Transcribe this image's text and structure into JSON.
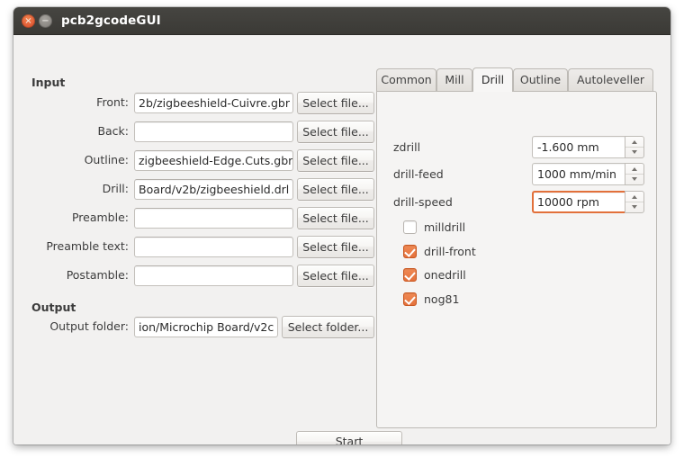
{
  "window": {
    "title": "pcb2gcodeGUI",
    "close_icon": "close-icon",
    "close_glyph": "×",
    "minimize_icon": "minimize-icon",
    "minimize_glyph": "−"
  },
  "colors": {
    "titlebar": "#3b3a36",
    "close_button": "#e4613a",
    "minimize_button": "#8e8b86",
    "accent": "#e4713c",
    "focus_ring": "#e2703a",
    "window_bg": "#f2f1f0",
    "panel_bg": "#f5f4f3"
  },
  "input_section": {
    "title": "Input",
    "rows": [
      {
        "label": "Front:",
        "value": "2b/zigbeeshield-Cuivre.gbr",
        "placeholder": "",
        "button": "Select file..."
      },
      {
        "label": "Back:",
        "value": "",
        "placeholder": "",
        "button": "Select file..."
      },
      {
        "label": "Outline:",
        "value": "zigbeeshield-Edge.Cuts.gbr",
        "placeholder": "",
        "button": "Select file..."
      },
      {
        "label": "Drill:",
        "value": "Board/v2b/zigbeeshield.drl",
        "placeholder": "",
        "button": "Select file..."
      },
      {
        "label": "Preamble:",
        "value": "",
        "placeholder": "",
        "button": "Select file..."
      },
      {
        "label": "Preamble text:",
        "value": "",
        "placeholder": "",
        "button": "Select file..."
      },
      {
        "label": "Postamble:",
        "value": "",
        "placeholder": "",
        "button": "Select file..."
      }
    ]
  },
  "output_section": {
    "title": "Output",
    "row": {
      "label": "Output folder:",
      "value": "ion/Microchip Board/v2c",
      "placeholder": "",
      "button": "Select folder..."
    }
  },
  "notebook": {
    "tabs": [
      {
        "label": "Common",
        "active": false
      },
      {
        "label": "Mill",
        "active": false
      },
      {
        "label": "Drill",
        "active": true
      },
      {
        "label": "Outline",
        "active": false
      },
      {
        "label": "Autoleveller",
        "active": false
      }
    ],
    "drill_tab": {
      "spinners": [
        {
          "label": "zdrill",
          "value": "-1.600 mm",
          "focused": false
        },
        {
          "label": "drill-feed",
          "value": "1000 mm/min",
          "focused": false
        },
        {
          "label": "drill-speed",
          "value": "10000 rpm",
          "focused": true
        }
      ],
      "checkboxes": [
        {
          "label": "milldrill",
          "checked": false
        },
        {
          "label": "drill-front",
          "checked": true
        },
        {
          "label": "onedrill",
          "checked": true
        },
        {
          "label": "nog81",
          "checked": true
        }
      ]
    }
  },
  "actions": {
    "start_label": "Start"
  }
}
